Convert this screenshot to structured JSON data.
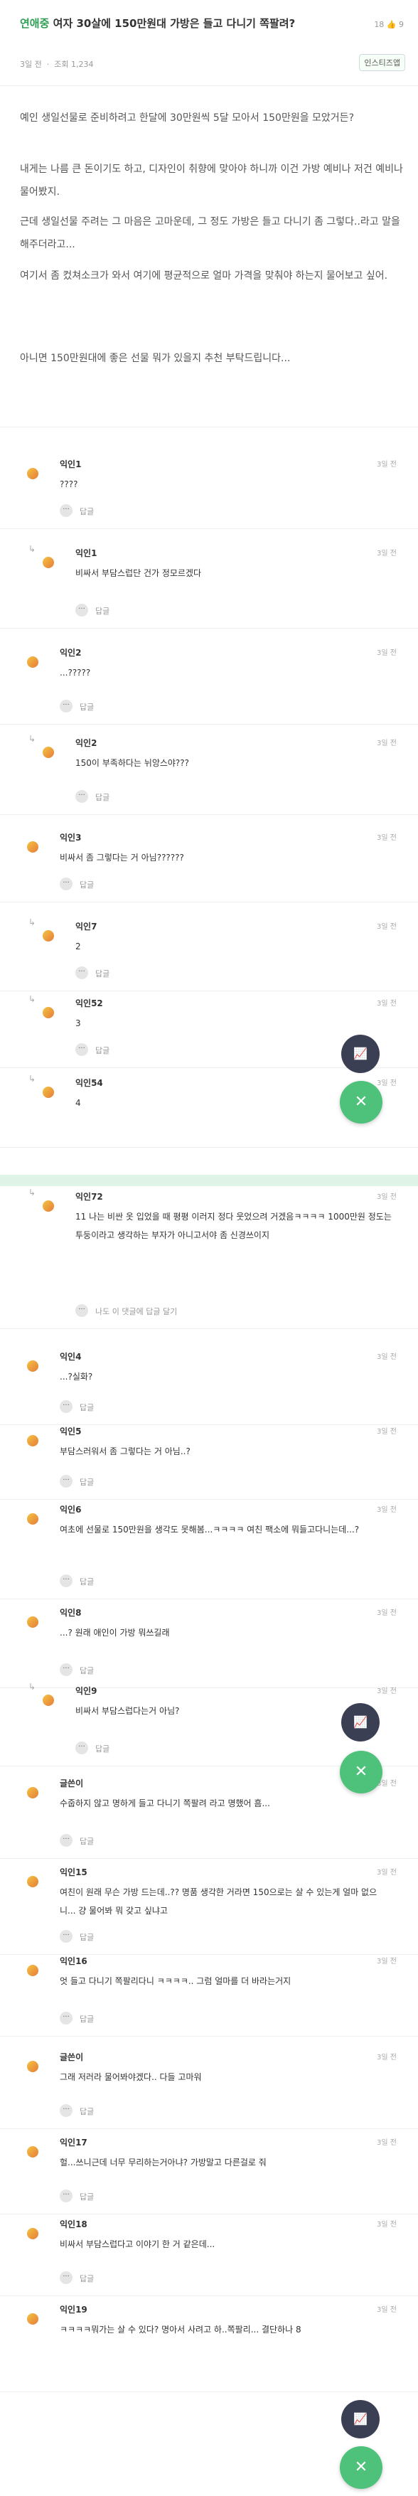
{
  "header": {
    "category": "연애중",
    "title": "여자 30살에 150만원대 가방은 들고 다니기 쪽팔려?",
    "meta_time": "3일 전",
    "meta_views": "조회 1,234",
    "stats": "18 👍 9",
    "ask_button": "인스티즈앱"
  },
  "post": {
    "p1": "예인 생일선물로 준비하려고 한달에 30만원씩 5달 모아서 150만원을 모았거든?",
    "p2": "내게는 나름 큰 돈이기도 하고, 디자인이 취향에 맞아야 하니까 이건 가방 예비나 저건 예비나 물어봤지.",
    "p3": "근데 생일선물 주려는 그 마음은 고마운데, 그 정도 가방은 들고 다니기 좀 그렇다..라고 말을 해주더라고...",
    "p4": "여기서 좀 컸쳐소크가 와서 여기에 평균적으로 얼마 가격을 맞춰야 하는지 물어보고 싶어.",
    "p5": "아니면 150만원대에 좋은 선물 뭐가 있을지 추천 부탁드립니다..."
  },
  "comments": [
    {
      "name": "익인1",
      "time": "3일 전",
      "text": "????",
      "reply": "답글",
      "sub": false
    },
    {
      "name": "익인1",
      "time": "3일 전",
      "text": "비싸서 부담스럽단 건가 정모르겠다",
      "reply": "답글",
      "sub": true
    },
    {
      "name": "익인2",
      "time": "3일 전",
      "text": "...?????",
      "reply": "답글",
      "sub": false
    },
    {
      "name": "익인2",
      "time": "3일 전",
      "text": "150이 부족하다는 뉘앙스야???",
      "reply": "답글",
      "sub": true
    },
    {
      "name": "익인3",
      "time": "3일 전",
      "text": "비싸서 좀 그렇다는 거 아님??????",
      "reply": "답글",
      "sub": false
    },
    {
      "name": "익인7",
      "time": "3일 전",
      "text": "2",
      "reply": "답글",
      "sub": true
    },
    {
      "name": "익인52",
      "time": "3일 전",
      "text": "3",
      "reply": "답글",
      "sub": true
    },
    {
      "name": "익인54",
      "time": "3일 전",
      "text": "4",
      "reply": "",
      "sub": true
    },
    {
      "name": "익인72",
      "time": "3일 전",
      "text": "11 나는 비싼 옷 입었을 때 평평 이러지 정다 웃었으려 거겠음ㅋㅋㅋㅋ 1000만원 정도는 투둥이라고 생각하는 부자가 아니고서야 좀 신경쓰이지",
      "reply": "나도 이 댓글에 답글 달기",
      "sub": true
    },
    {
      "name": "익인4",
      "time": "3일 전",
      "text": "...?실화?",
      "reply": "답글",
      "sub": false
    },
    {
      "name": "익인5",
      "time": "3일 전",
      "text": "부담스러워서 좀 그렇다는 거 아님..?",
      "reply": "답글",
      "sub": false
    },
    {
      "name": "익인6",
      "time": "3일 전",
      "text": "여초에 선물로 150만원을 생각도 못해봄...ㅋㅋㅋㅋ 여친 팩소에 뭐들고다니는데...?",
      "reply": "답글",
      "sub": false
    },
    {
      "name": "익인8",
      "time": "3일 전",
      "text": "...? 원래 애인이 가방 뭐쓰길래",
      "reply": "답글",
      "sub": false
    },
    {
      "name": "익인9",
      "time": "3일 전",
      "text": "비싸서 부담스럽다는거 아님?",
      "reply": "답글",
      "sub": true
    },
    {
      "name": "글쓴이",
      "time": "3일 전",
      "text": "수줍하지 않고 명하게 들고 다니기 쪽팔려 라고 명했어 흠...",
      "reply": "답글",
      "sub": false
    },
    {
      "name": "익인15",
      "time": "3일 전",
      "text": "여친이 원래 무슨 가방 드는데..?? 명품 생각한 거라면 150으로는 살 수 있는게 얼마 없으니... 걍 물어봐 뭐 갖고 싶냐고",
      "reply": "답글",
      "sub": false
    },
    {
      "name": "익인16",
      "time": "3일 전",
      "text": "엇 들고 다니기 쪽팔리다니 ㅋㅋㅋㅋ.. 그럼 얼마를 더 바라는거지",
      "reply": "답글",
      "sub": false
    },
    {
      "name": "글쓴이",
      "time": "3일 전",
      "text": "그래 저러라 물어봐야겠다.. 다들 고마워",
      "reply": "답글",
      "sub": false
    },
    {
      "name": "익인17",
      "time": "3일 전",
      "text": "헐...쓰니근데 너무 무리하는거아냐? 가방말고 다른걸로 줘",
      "reply": "답글",
      "sub": false
    },
    {
      "name": "익인18",
      "time": "3일 전",
      "text": "비싸서 부담스럽다고 이야기 한 거 같은데...",
      "reply": "답글",
      "sub": false
    },
    {
      "name": "익인19",
      "time": "3일 전",
      "text": "ㅋㅋㅋㅋ뭐가는 살 수 있다? 명아서 사려고 하..쪽팔리... 결단하나 8",
      "reply": "",
      "sub": false
    }
  ],
  "colors": {
    "accent": "#2e9e55",
    "fab": "#4ec27a",
    "fab_dark": "#3b3f54"
  }
}
